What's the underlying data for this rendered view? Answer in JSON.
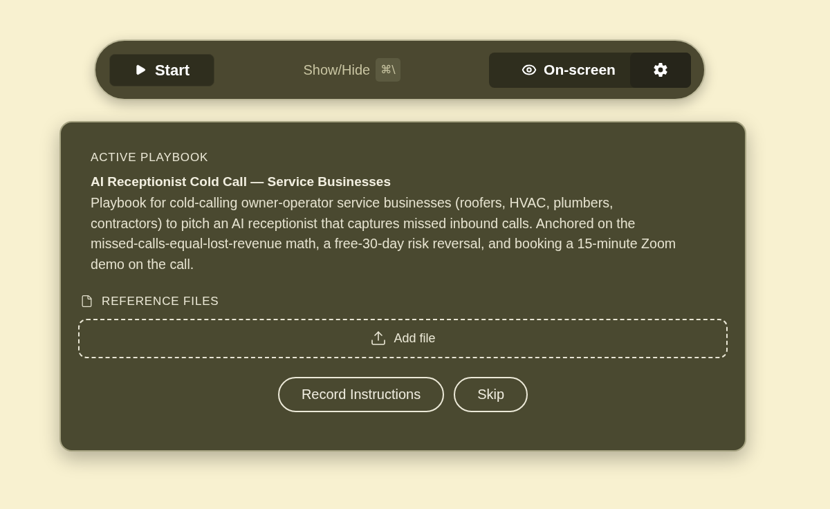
{
  "toolbar": {
    "start_button": {
      "label": "Start"
    },
    "shortcut": {
      "label": "Show/Hide",
      "keys": "⌘\\"
    },
    "visibility_button": {
      "label": "On-screen"
    }
  },
  "playbook": {
    "heading": "ACTIVE PLAYBOOK",
    "title": "AI Receptionist Cold Call — Service Businesses",
    "description": "Playbook for cold-calling owner-operator service businesses (roofers, HVAC, plumbers, contractors) to pitch an AI receptionist that captures missed inbound calls. Anchored on the missed-calls-equal-lost-revenue math, a free-30-day risk reversal, and booking a 15-minute Zoom demo on the call."
  },
  "reference_files": {
    "heading": "REFERENCE FILES",
    "add_button": "Add file"
  },
  "actions": [
    "Record Instructions",
    "Skip"
  ]
}
